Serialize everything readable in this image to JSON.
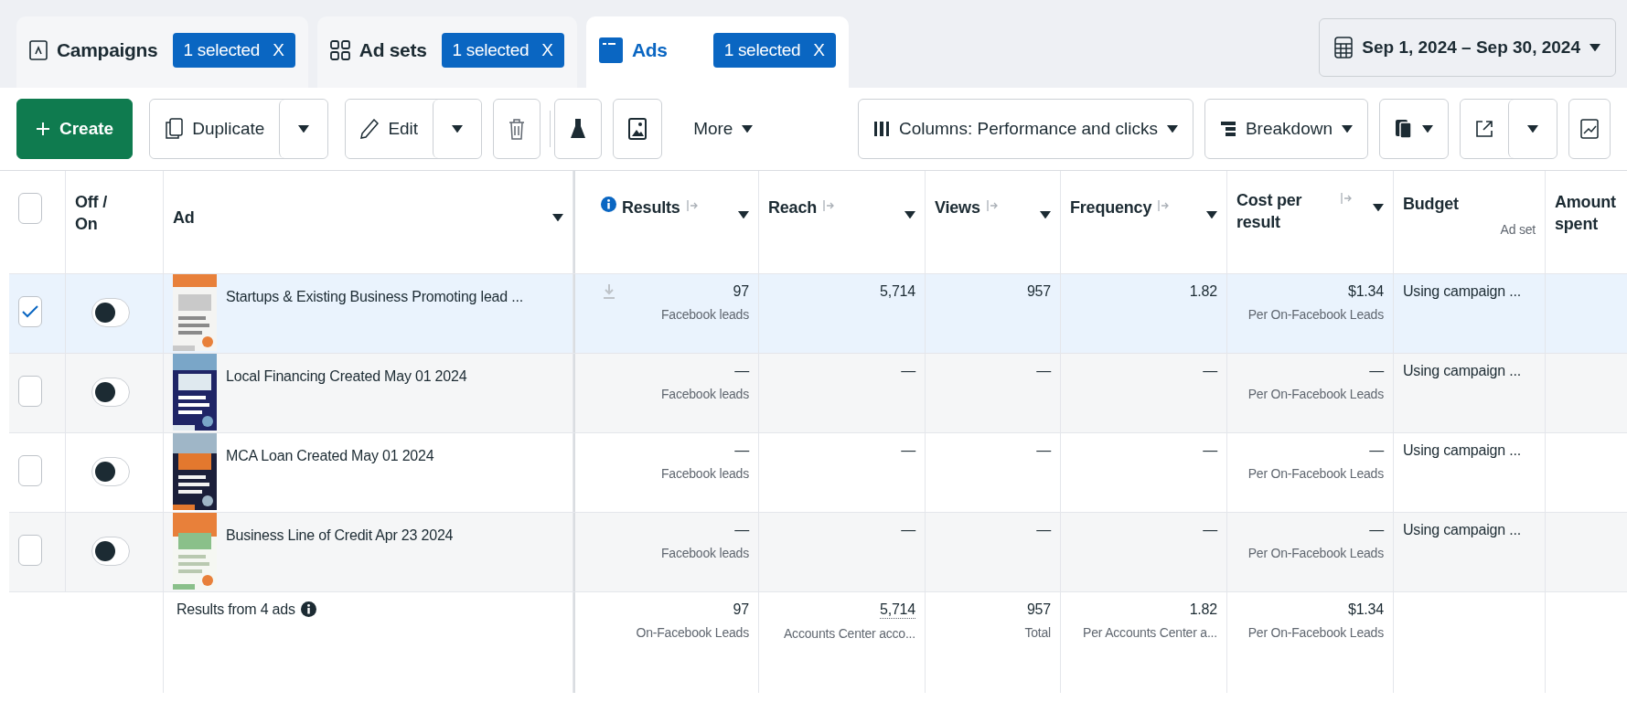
{
  "tabs": [
    {
      "label": "Campaigns",
      "badge": "1 selected",
      "clear": "X",
      "selected": false
    },
    {
      "label": "Ad sets",
      "badge": "1 selected",
      "clear": "X",
      "selected": false
    },
    {
      "label": "Ads",
      "badge": "1 selected",
      "clear": "X",
      "selected": true
    }
  ],
  "date_range": {
    "label": "Sep 1, 2024 – Sep 30, 2024"
  },
  "toolbar": {
    "create": "Create",
    "duplicate": "Duplicate",
    "edit": "Edit",
    "more": "More",
    "columns": "Columns: Performance and clicks",
    "breakdown": "Breakdown"
  },
  "table": {
    "all_checked": false,
    "columns": [
      {
        "kind": "toggle",
        "label": "Off / On"
      },
      {
        "kind": "name",
        "label": "Ad"
      },
      {
        "kind": "metric",
        "label": "Results",
        "info": true
      },
      {
        "kind": "metric",
        "label": "Reach",
        "info": false
      },
      {
        "kind": "metric",
        "label": "Views",
        "info": false
      },
      {
        "kind": "metric",
        "label": "Frequency",
        "info": false
      },
      {
        "kind": "metric",
        "label": "Cost per result",
        "info": false
      },
      {
        "kind": "budget",
        "label": "Budget",
        "sublabel": "Ad set"
      },
      {
        "kind": "plain",
        "label": "Amount spent"
      }
    ],
    "rows": [
      {
        "checked": true,
        "on": false,
        "name": "Startups & Existing Business Promoting lead ...",
        "download_icon": true,
        "results": "97",
        "results_label": "Facebook leads",
        "reach": "5,714",
        "views": "957",
        "frequency": "1.82",
        "cost": "$1.34",
        "cost_label": "Per On-Facebook Leads",
        "budget": "Using campaign ..."
      },
      {
        "checked": false,
        "on": false,
        "name": "Local Financing Created May 01 2024",
        "download_icon": false,
        "results": "—",
        "results_label": "Facebook leads",
        "reach": "—",
        "views": "—",
        "frequency": "—",
        "cost": "—",
        "cost_label": "Per On-Facebook Leads",
        "budget": "Using campaign ..."
      },
      {
        "checked": false,
        "on": false,
        "name": "MCA Loan Created May 01 2024",
        "download_icon": false,
        "results": "—",
        "results_label": "Facebook leads",
        "reach": "—",
        "views": "—",
        "frequency": "—",
        "cost": "—",
        "cost_label": "Per On-Facebook Leads",
        "budget": "Using campaign ..."
      },
      {
        "checked": false,
        "on": false,
        "name": "Business Line of Credit Apr 23 2024",
        "download_icon": false,
        "results": "—",
        "results_label": "Facebook leads",
        "reach": "—",
        "views": "—",
        "frequency": "—",
        "cost": "—",
        "cost_label": "Per On-Facebook Leads",
        "budget": "Using campaign ..."
      }
    ],
    "summary": {
      "label": "Results from 4 ads",
      "results": "97",
      "results_label": "On-Facebook Leads",
      "reach": "5,714",
      "reach_label": "Accounts Center acco...",
      "views": "957",
      "views_label": "Total",
      "frequency": "1.82",
      "frequency_label": "Per Accounts Center a...",
      "cost": "$1.34",
      "cost_label": "Per On-Facebook Leads"
    }
  }
}
